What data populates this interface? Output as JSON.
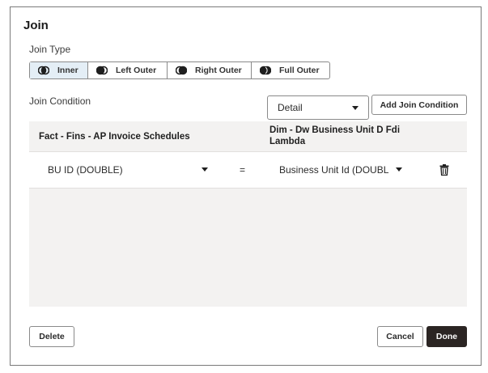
{
  "dialog": {
    "title": "Join",
    "join_type_label": "Join Type",
    "join_types": [
      {
        "label": "Inner",
        "active": true
      },
      {
        "label": "Left Outer",
        "active": false
      },
      {
        "label": "Right Outer",
        "active": false
      },
      {
        "label": "Full Outer",
        "active": false
      }
    ],
    "join_condition_label": "Join Condition",
    "detail_select": {
      "value": "Detail"
    },
    "add_join_condition_label": "Add Join Condition",
    "columns": {
      "left": "Fact - Fins - AP Invoice Schedules",
      "right": "Dim - Dw Business Unit D Fdi Lambda"
    },
    "conditions": [
      {
        "left_field": "BU ID (DOUBLE)",
        "operator": "=",
        "right_field": "Business Unit Id (DOUBL"
      }
    ],
    "delete_label": "Delete",
    "cancel_label": "Cancel",
    "done_label": "Done"
  }
}
